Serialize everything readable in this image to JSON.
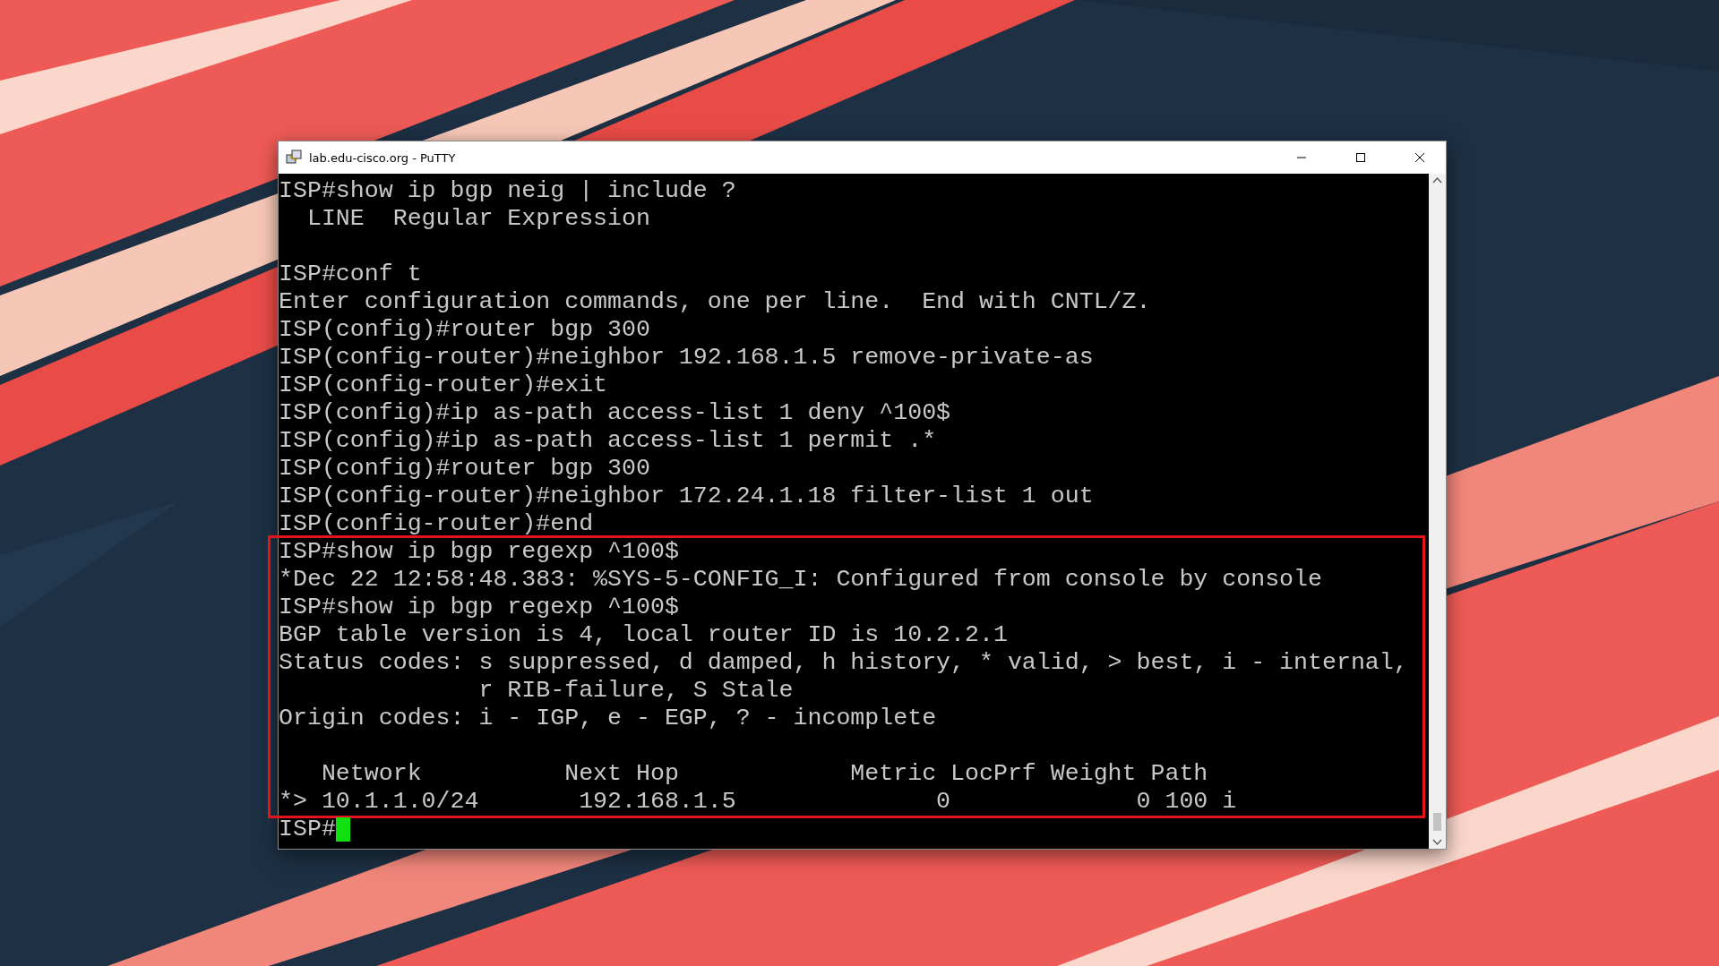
{
  "window": {
    "title": "lab.edu-cisco.org - PuTTY"
  },
  "terminal": {
    "blocks": [
      {
        "highlighted": false,
        "lines": [
          {
            "kind": "text",
            "text": "ISP#show ip bgp neig | include ?"
          },
          {
            "kind": "text",
            "text": "  LINE  Regular Expression"
          },
          {
            "kind": "blank"
          },
          {
            "kind": "text",
            "text": "ISP#conf t"
          },
          {
            "kind": "text",
            "text": "Enter configuration commands, one per line.  End with CNTL/Z."
          },
          {
            "kind": "text",
            "text": "ISP(config)#router bgp 300"
          },
          {
            "kind": "text",
            "text": "ISP(config-router)#neighbor 192.168.1.5 remove-private-as"
          },
          {
            "kind": "text",
            "text": "ISP(config-router)#exit"
          },
          {
            "kind": "text",
            "text": "ISP(config)#ip as-path access-list 1 deny ^100$"
          },
          {
            "kind": "text",
            "text": "ISP(config)#ip as-path access-list 1 permit .*"
          },
          {
            "kind": "text",
            "text": "ISP(config)#router bgp 300"
          },
          {
            "kind": "text",
            "text": "ISP(config-router)#neighbor 172.24.1.18 filter-list 1 out"
          },
          {
            "kind": "text",
            "text": "ISP(config-router)#end"
          }
        ]
      },
      {
        "highlighted": true,
        "lines": [
          {
            "kind": "text",
            "text": "ISP#show ip bgp regexp ^100$"
          },
          {
            "kind": "text",
            "text": "*Dec 22 12:58:48.383: %SYS-5-CONFIG_I: Configured from console by console"
          },
          {
            "kind": "text",
            "text": "ISP#show ip bgp regexp ^100$"
          },
          {
            "kind": "text",
            "text": "BGP table version is 4, local router ID is 10.2.2.1"
          },
          {
            "kind": "text",
            "text": "Status codes: s suppressed, d damped, h history, * valid, > best, i - internal,"
          },
          {
            "kind": "text",
            "text": "              r RIB-failure, S Stale"
          },
          {
            "kind": "text",
            "text": "Origin codes: i - IGP, e - EGP, ? - incomplete"
          },
          {
            "kind": "blank"
          },
          {
            "kind": "text",
            "text": "   Network          Next Hop            Metric LocPrf Weight Path"
          },
          {
            "kind": "text",
            "text": "*> 10.1.1.0/24       192.168.1.5              0             0 100 i"
          }
        ]
      },
      {
        "highlighted": false,
        "lines": [
          {
            "kind": "prompt",
            "text": "ISP#"
          }
        ]
      }
    ]
  }
}
